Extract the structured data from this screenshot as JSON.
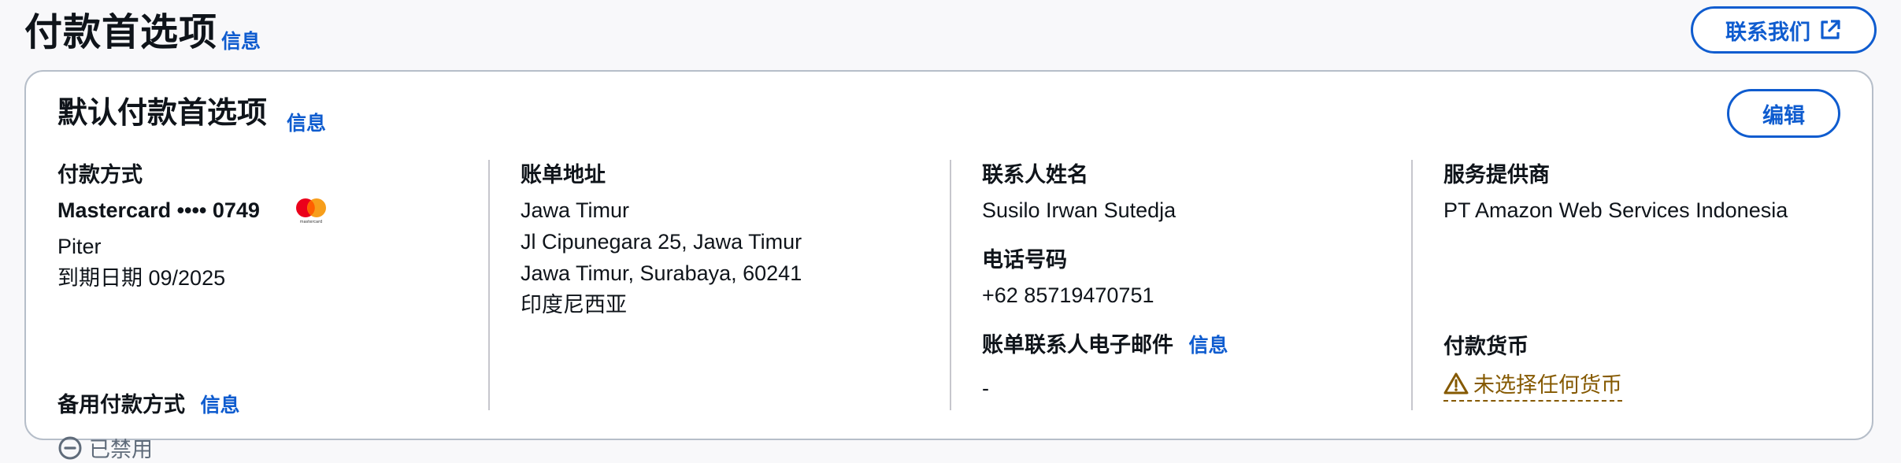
{
  "header": {
    "title": "付款首选项",
    "info_link": "信息",
    "contact_button": "联系我们"
  },
  "card": {
    "title": "默认付款首选项",
    "info_link": "信息",
    "edit_button": "编辑",
    "payment_method": {
      "label": "付款方式",
      "card_line": "Mastercard •••• 0749",
      "brand_mark": "mastercard",
      "holder": "Piter",
      "expiry": "到期日期 09/2025"
    },
    "backup_payment": {
      "label": "备用付款方式",
      "info_link": "信息",
      "status": "已禁用"
    },
    "billing_address": {
      "label": "账单地址",
      "lines": [
        "Jawa Timur",
        "Jl Cipunegara 25, Jawa Timur",
        "Jawa Timur, Surabaya, 60241",
        "印度尼西亚"
      ]
    },
    "contact_name": {
      "label": "联系人姓名",
      "value": "Susilo Irwan Sutedja"
    },
    "phone": {
      "label": "电话号码",
      "value": "+62 85719470751"
    },
    "billing_email": {
      "label": "账单联系人电子邮件",
      "info_link": "信息",
      "value": "-"
    },
    "service_provider": {
      "label": "服务提供商",
      "value": "PT Amazon Web Services Indonesia"
    },
    "payment_currency": {
      "label": "付款货币",
      "warning": "未选择任何货币"
    }
  },
  "icons": {
    "external_link": "external-link-icon",
    "disabled": "minus-circle-icon",
    "warning": "warning-triangle-icon",
    "card_brand": "mastercard-logo-icon"
  },
  "colors": {
    "link": "#0f5ccf",
    "warning": "#855900",
    "muted": "#5f6b7a",
    "border": "#b6bec9"
  }
}
